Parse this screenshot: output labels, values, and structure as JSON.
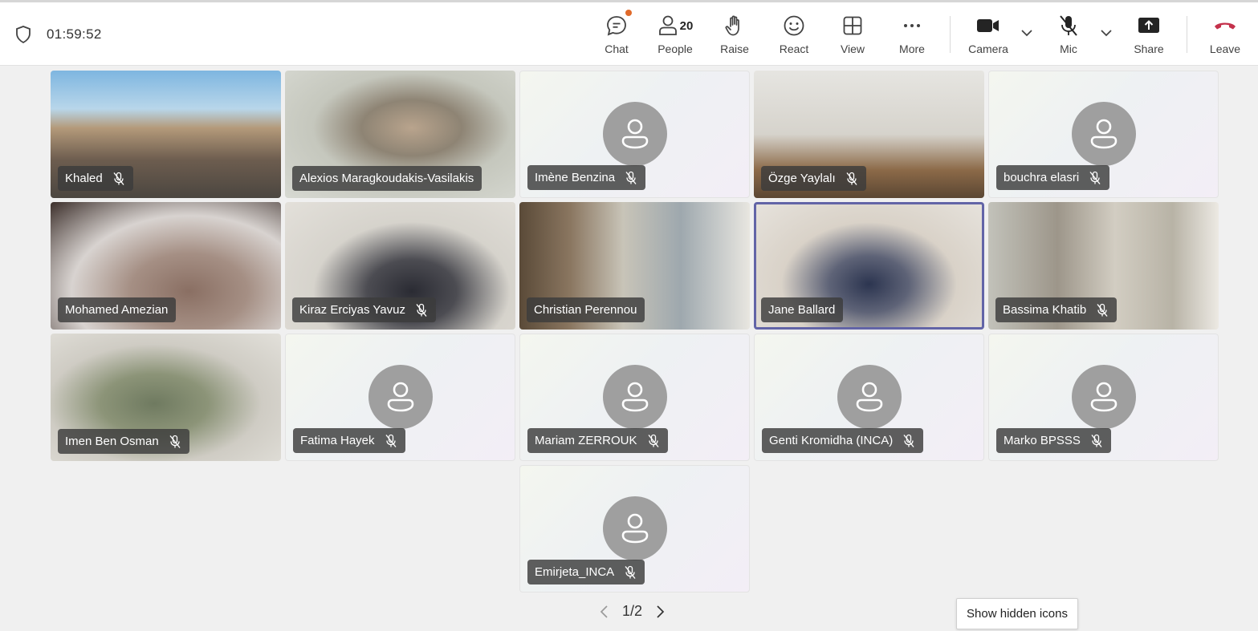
{
  "meeting": {
    "timer": "01:59:52"
  },
  "toolbar": {
    "chat": "Chat",
    "people": "People",
    "people_count": "20",
    "raise": "Raise",
    "react": "React",
    "view": "View",
    "more": "More",
    "camera": "Camera",
    "mic": "Mic",
    "share": "Share",
    "leave": "Leave",
    "leave_color": "#c4314b",
    "chat_badge_color": "#e06a2a"
  },
  "participants": [
    {
      "name": "Khaled",
      "video": true,
      "muted": true
    },
    {
      "name": "Alexios Maragkoudakis-Vasilakis",
      "video": true,
      "muted": false
    },
    {
      "name": "Imène Benzina",
      "video": false,
      "muted": true
    },
    {
      "name": "Özge Yaylalı",
      "video": true,
      "muted": true
    },
    {
      "name": "bouchra elasri",
      "video": false,
      "muted": true
    },
    {
      "name": "Mohamed Amezian",
      "video": true,
      "muted": false
    },
    {
      "name": "Kiraz Erciyas Yavuz",
      "video": true,
      "muted": true
    },
    {
      "name": "Christian Perennou",
      "video": true,
      "muted": false
    },
    {
      "name": "Jane Ballard",
      "video": true,
      "muted": false,
      "speaking": true
    },
    {
      "name": "Bassima Khatib",
      "video": true,
      "muted": true
    },
    {
      "name": "Imen Ben Osman",
      "video": true,
      "muted": true
    },
    {
      "name": "Fatima Hayek",
      "video": false,
      "muted": true
    },
    {
      "name": "Mariam ZERROUK",
      "video": false,
      "muted": true
    },
    {
      "name": "Genti Kromidha (INCA)",
      "video": false,
      "muted": true
    },
    {
      "name": "Marko BPSSS",
      "video": false,
      "muted": true
    },
    {
      "name": "Emirjeta_INCA",
      "video": false,
      "muted": true
    }
  ],
  "pagination": {
    "label": "1/2"
  },
  "tooltip": {
    "text": "Show hidden icons"
  },
  "colors": {
    "accent": "#6264a7",
    "avatar": "#9f9f9f"
  }
}
